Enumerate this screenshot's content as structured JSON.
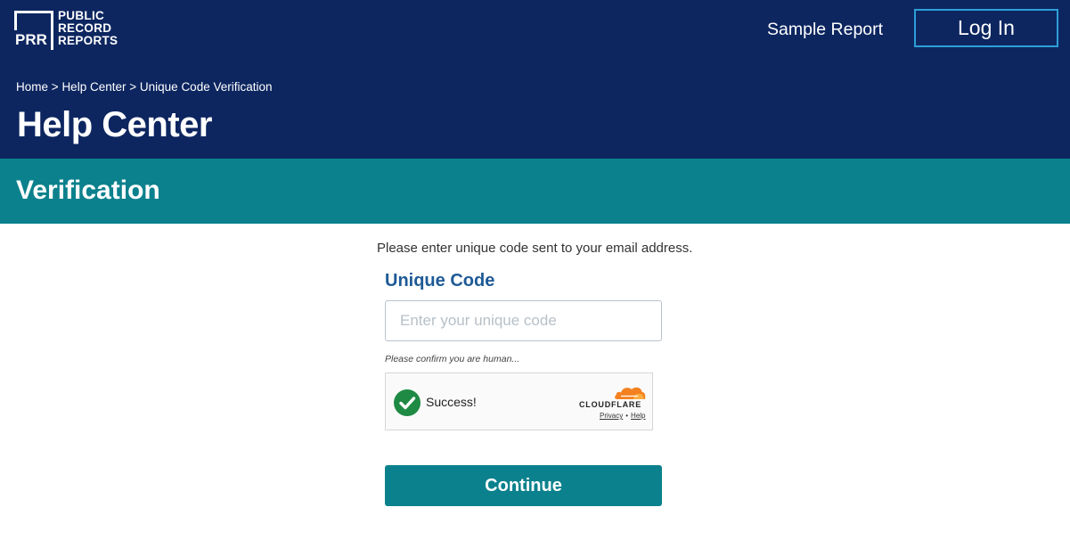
{
  "header": {
    "logo": {
      "abbr": "PRR",
      "line1": "PUBLIC",
      "line2": "RECORD",
      "line3": "REPORTS"
    },
    "nav_sample_report": "Sample Report",
    "login_label": "Log In",
    "background_color": "#0d2660"
  },
  "breadcrumb": {
    "home": "Home",
    "help_center": "Help Center",
    "current": "Unique Code Verification",
    "separator": ">"
  },
  "page_title": "Help Center",
  "banner": {
    "title": "Verification",
    "background_color": "#0b818d"
  },
  "form": {
    "instructions": "Please enter unique code sent to your email address.",
    "code_label": "Unique Code",
    "code_value": "",
    "code_placeholder": "Enter your unique code",
    "human_note": "Please confirm you are human...",
    "continue_label": "Continue"
  },
  "captcha": {
    "status": "Success!",
    "brand": "CLOUDFLARE",
    "privacy_label": "Privacy",
    "links_separator": "•",
    "help_label": "Help",
    "check_icon": "check-circle-icon",
    "success_color": "#1e8a44"
  }
}
